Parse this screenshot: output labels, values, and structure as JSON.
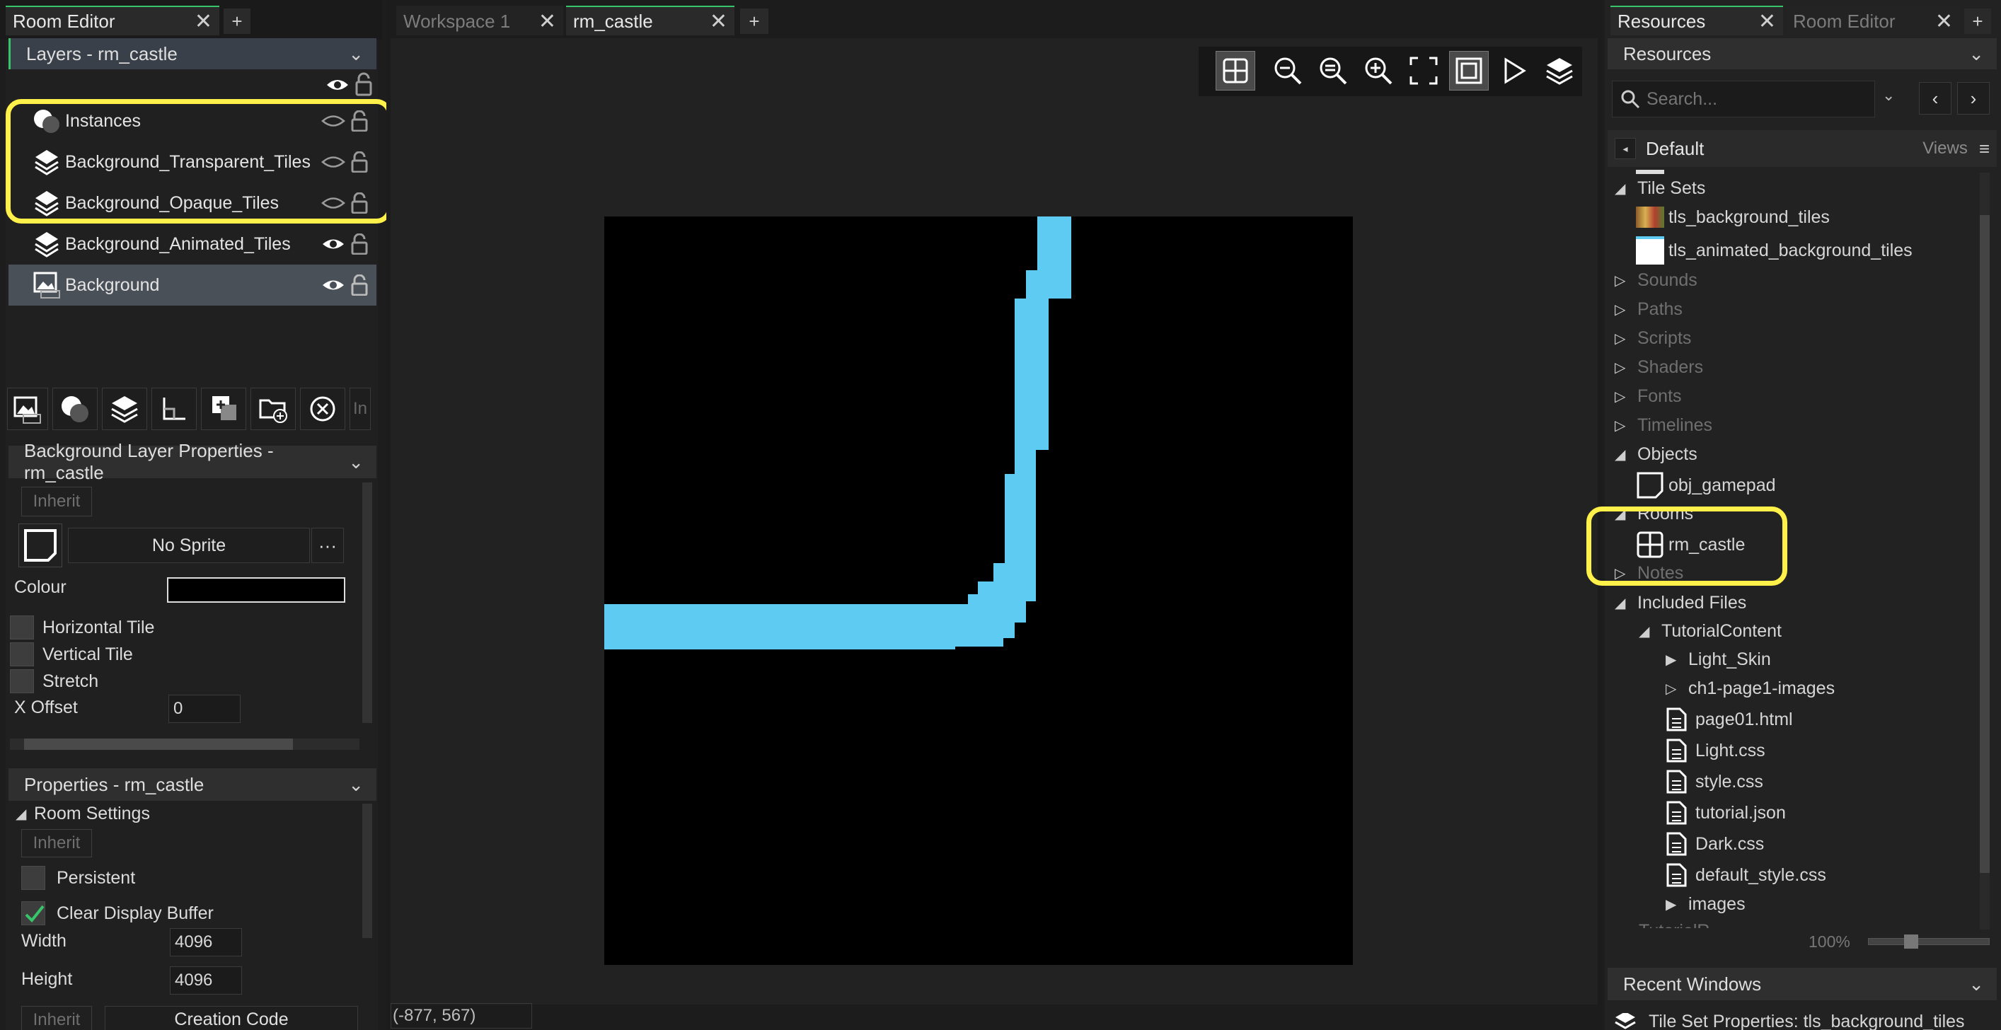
{
  "left_tabs": {
    "room_editor": "Room Editor",
    "plus": "+"
  },
  "layers_panel": {
    "title": "Layers - rm_castle",
    "layers": [
      {
        "name": "Instances"
      },
      {
        "name": "Background_Transparent_Tiles"
      },
      {
        "name": "Background_Opaque_Tiles"
      },
      {
        "name": "Background_Animated_Tiles"
      },
      {
        "name": "Background"
      }
    ],
    "toolbar_tail": "In"
  },
  "bg_props": {
    "title": "Background Layer Properties - rm_castle",
    "inherit": "Inherit",
    "sprite": "No Sprite",
    "more": "···",
    "colour_label": "Colour",
    "horizontal_tile": "Horizontal Tile",
    "vertical_tile": "Vertical Tile",
    "stretch": "Stretch",
    "x_offset_label": "X Offset",
    "x_offset_value": "0"
  },
  "room_props": {
    "title": "Properties - rm_castle",
    "room_settings": "Room Settings",
    "inherit": "Inherit",
    "persistent": "Persistent",
    "clear_display_buffer": "Clear Display Buffer",
    "width_label": "Width",
    "width_value": "4096",
    "height_label": "Height",
    "height_value": "4096",
    "inherit2": "Inherit",
    "creation_code": "Creation Code"
  },
  "center_tabs": {
    "workspace": "Workspace 1",
    "room": "rm_castle",
    "plus": "+"
  },
  "status": {
    "coords": "(-877, 567)"
  },
  "room_view": {
    "background_colour": "#000000",
    "path_colour": "#5ecbf2"
  },
  "right_tabs": {
    "resources": "Resources",
    "room_editor": "Room Editor",
    "plus": "+"
  },
  "resources_panel": {
    "title": "Resources",
    "search_placeholder": "Search...",
    "view_name": "Default",
    "views_label": "Views",
    "tree": {
      "tile_sets": "Tile Sets",
      "tls_background_tiles": "tls_background_tiles",
      "tls_animated_background_tiles": "tls_animated_background_tiles",
      "sounds": "Sounds",
      "paths": "Paths",
      "scripts": "Scripts",
      "shaders": "Shaders",
      "fonts": "Fonts",
      "timelines": "Timelines",
      "objects": "Objects",
      "obj_gamepad": "obj_gamepad",
      "rooms": "Rooms",
      "rm_castle": "rm_castle",
      "notes": "Notes",
      "included_files": "Included Files",
      "tutorial_content": "TutorialContent",
      "light_skin": "Light_Skin",
      "ch1_images": "ch1-page1-images",
      "files": [
        "page01.html",
        "Light.css",
        "style.css",
        "tutorial.json",
        "Dark.css",
        "default_style.css"
      ],
      "images": "images",
      "tutorial_cut": "TutorialR..."
    },
    "zoom": "100%"
  },
  "recent_windows": {
    "title": "Recent Windows",
    "item": "Tile Set Properties: tls_background_tiles"
  },
  "colors": {
    "accent_green": "#38c56a",
    "highlight_yellow": "#fff04a"
  }
}
